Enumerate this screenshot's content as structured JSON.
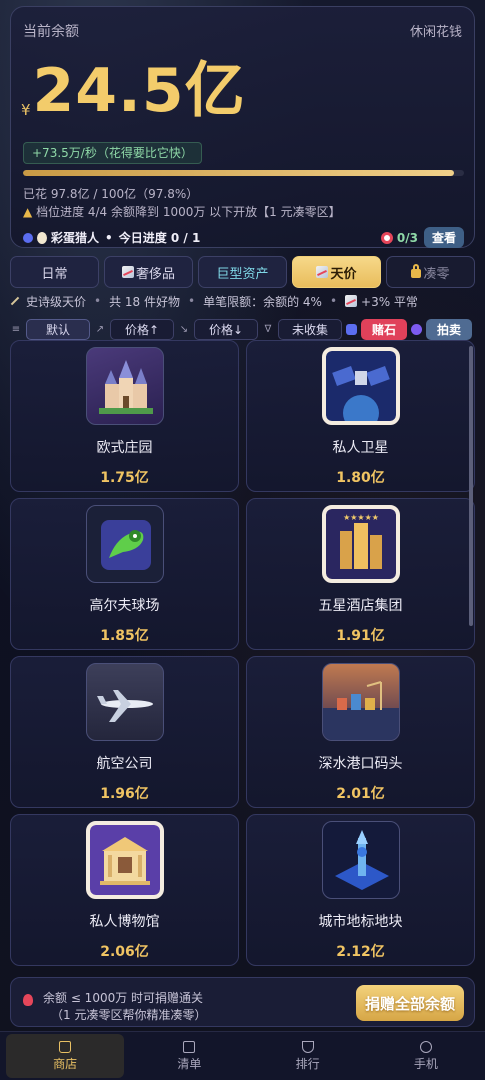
{
  "balance": {
    "label": "当前余额",
    "mode": "休闲花钱",
    "currency": "¥",
    "value": "24.5亿",
    "rate": "+73.5万/秒（花得要比它快）",
    "progress_fraction": 0.978,
    "spent": "已花 97.8亿 / 100亿（97.8%）",
    "tier": "档位进度 4/4    余额降到 1000万 以下开放【1 元凑零区】",
    "title_badge": "彩蛋猎人",
    "daily": "今日进度 0 / 1",
    "target_count": "0/3",
    "view_label": "查看"
  },
  "tabs": [
    {
      "label": "日常",
      "state": "normal"
    },
    {
      "label": "奢侈品",
      "state": "normal",
      "icon": "chart-icon"
    },
    {
      "label": "巨型资产",
      "state": "asset"
    },
    {
      "label": "天价",
      "state": "active",
      "icon": "chart-icon"
    },
    {
      "label": "凑零",
      "state": "locked",
      "icon": "lock-icon"
    }
  ],
  "info": {
    "tier_name": "史诗级天价",
    "count": "共 18 件好物",
    "limit": "单笔限额：余额的 4%",
    "trend": "+3% 平常"
  },
  "filters": {
    "default": "默认",
    "price_up": "价格↑",
    "price_down": "价格↓",
    "uncollected": "未收集",
    "gamble": "赌石",
    "auction": "拍卖"
  },
  "items": [
    {
      "name": "欧式庄园",
      "price": "1.75亿",
      "icon": "castle-icon"
    },
    {
      "name": "私人卫星",
      "price": "1.80亿",
      "icon": "satellite-icon"
    },
    {
      "name": "高尔夫球场",
      "price": "1.85亿",
      "icon": "golf-icon"
    },
    {
      "name": "五星酒店集团",
      "price": "1.91亿",
      "icon": "hotel-icon"
    },
    {
      "name": "航空公司",
      "price": "1.96亿",
      "icon": "airplane-icon"
    },
    {
      "name": "深水港口码头",
      "price": "2.01亿",
      "icon": "port-icon"
    },
    {
      "name": "私人博物馆",
      "price": "2.06亿",
      "icon": "museum-icon"
    },
    {
      "name": "城市地标地块",
      "price": "2.12亿",
      "icon": "tower-icon"
    }
  ],
  "donate": {
    "line1": "余额 ≤ 1000万 时可捐赠通关",
    "line2": "（1 元凑零区帮你精准凑零）",
    "button": "捐赠全部余额"
  },
  "nav": [
    {
      "label": "商店",
      "icon": "bag-icon",
      "active": true
    },
    {
      "label": "清单",
      "icon": "list-icon",
      "active": false
    },
    {
      "label": "排行",
      "icon": "trophy-icon",
      "active": false
    },
    {
      "label": "手机",
      "icon": "gear-icon",
      "active": false
    }
  ],
  "colors": {
    "accent_gold": "#f3cc6b",
    "gain_green": "#8fd9a8",
    "danger_red": "#e0415a",
    "panel_bg": "#1a1d36"
  }
}
